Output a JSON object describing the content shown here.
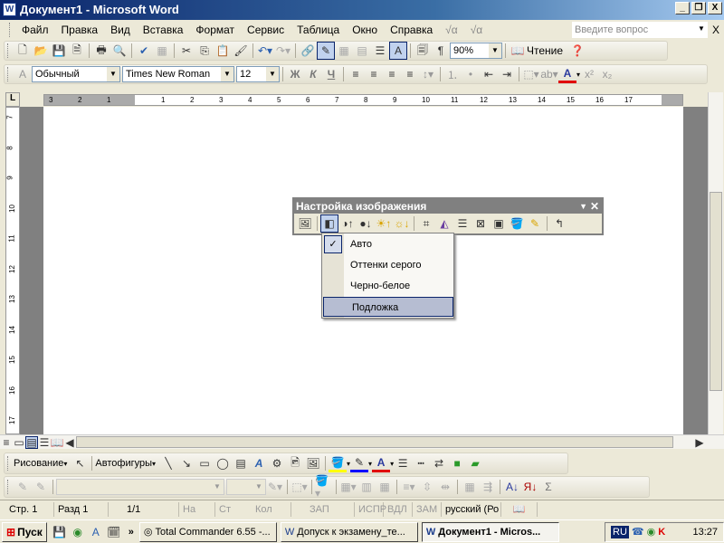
{
  "window": {
    "title": "Документ1 - Microsoft Word",
    "minimize": "_",
    "restore": "❐",
    "close": "X"
  },
  "menu": {
    "items": [
      "Файл",
      "Правка",
      "Вид",
      "Вставка",
      "Формат",
      "Сервис",
      "Таблица",
      "Окно",
      "Справка"
    ],
    "help_placeholder": "Введите вопрос",
    "close_doc": "X"
  },
  "standard": {
    "zoom": "90%",
    "reading": "Чтение",
    "pilcrow": "¶"
  },
  "formatting": {
    "style": "Обычный",
    "font": "Times New Roman",
    "size": "12",
    "bold": "Ж",
    "italic": "К",
    "underline": "Ч",
    "font_color": "#e00000"
  },
  "ruler": {
    "h": [
      "3",
      "2",
      "1",
      "1",
      "2",
      "3",
      "4",
      "5",
      "6",
      "7",
      "8",
      "9",
      "10",
      "11",
      "12",
      "13",
      "14",
      "15",
      "16",
      "17"
    ],
    "v": [
      "7",
      "8",
      "9",
      "10",
      "11",
      "12",
      "13",
      "14",
      "15",
      "16",
      "17"
    ],
    "tab": "L"
  },
  "picture_toolbar": {
    "title": "Настройка изображения"
  },
  "color_menu": {
    "items": [
      "Авто",
      "Оттенки серого",
      "Черно-белое",
      "Подложка"
    ],
    "checked": "✓"
  },
  "drawing": {
    "draw": "Рисование",
    "autoshapes": "Автофигуры"
  },
  "status": {
    "page": "Стр. 1",
    "section": "Разд 1",
    "pages": "1/1",
    "at": "На",
    "line": "Ст",
    "col": "Кол",
    "rec": "ЗАП",
    "trk": "ИСПР",
    "ext": "ВДЛ",
    "ovr": "ЗАМ",
    "lang": "русский (Ро"
  },
  "taskbar": {
    "start": "Пуск",
    "more": "»",
    "buttons": [
      "Total Commander 6.55 -...",
      "Допуск к экзамену_те...",
      "Документ1 - Micros..."
    ],
    "lang": "RU",
    "clock": "13:27"
  }
}
